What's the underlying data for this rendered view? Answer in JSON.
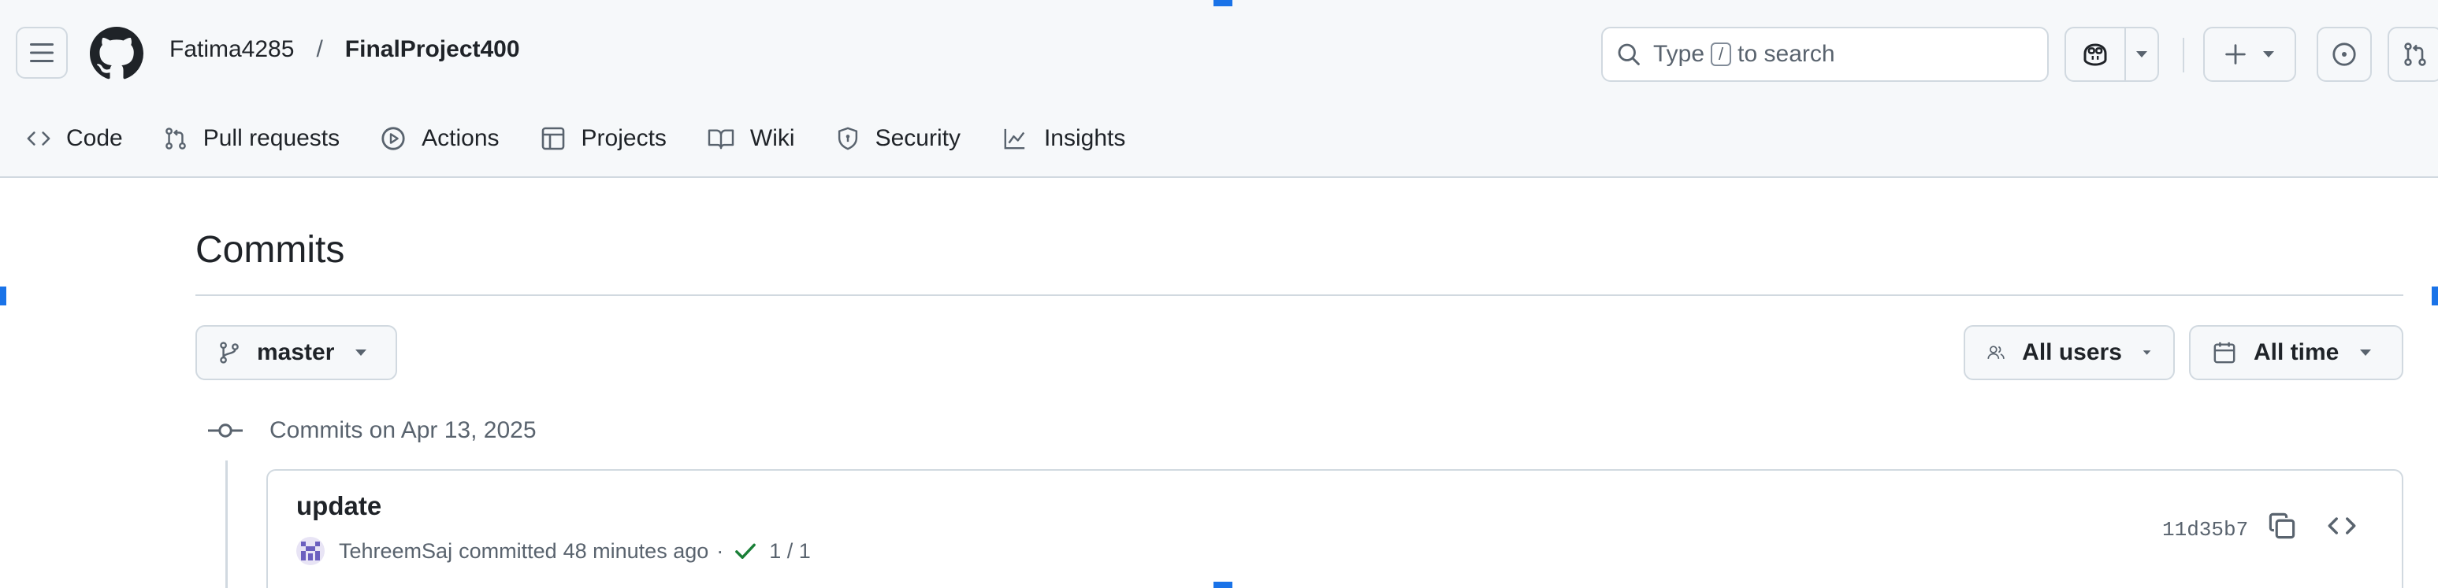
{
  "header": {
    "owner": "Fatima4285",
    "separator": "/",
    "repo": "FinalProject400",
    "search": {
      "prefix": "Type",
      "key": "/",
      "suffix": "to search"
    }
  },
  "nav": {
    "tabs": [
      {
        "label": "Code",
        "icon": "code-icon"
      },
      {
        "label": "Pull requests",
        "icon": "git-pull-request-icon"
      },
      {
        "label": "Actions",
        "icon": "play-icon"
      },
      {
        "label": "Projects",
        "icon": "table-icon"
      },
      {
        "label": "Wiki",
        "icon": "book-icon"
      },
      {
        "label": "Security",
        "icon": "shield-icon"
      },
      {
        "label": "Insights",
        "icon": "graph-icon"
      }
    ]
  },
  "main": {
    "title": "Commits",
    "branch": "master",
    "users_filter": "All users",
    "time_filter": "All time",
    "group_heading": "Commits on Apr 13, 2025",
    "commits": [
      {
        "message": "update",
        "author": "TehreemSaj",
        "action": "committed",
        "time": "48 minutes ago",
        "separator": "·",
        "checks": "1 / 1",
        "sha": "11d35b7"
      }
    ]
  },
  "colors": {
    "header_bg": "#f6f8fa",
    "border": "#d1d9e0",
    "text": "#1f2328",
    "muted": "#59636e",
    "success": "#1a7f37",
    "selection": "#1a73e8"
  }
}
